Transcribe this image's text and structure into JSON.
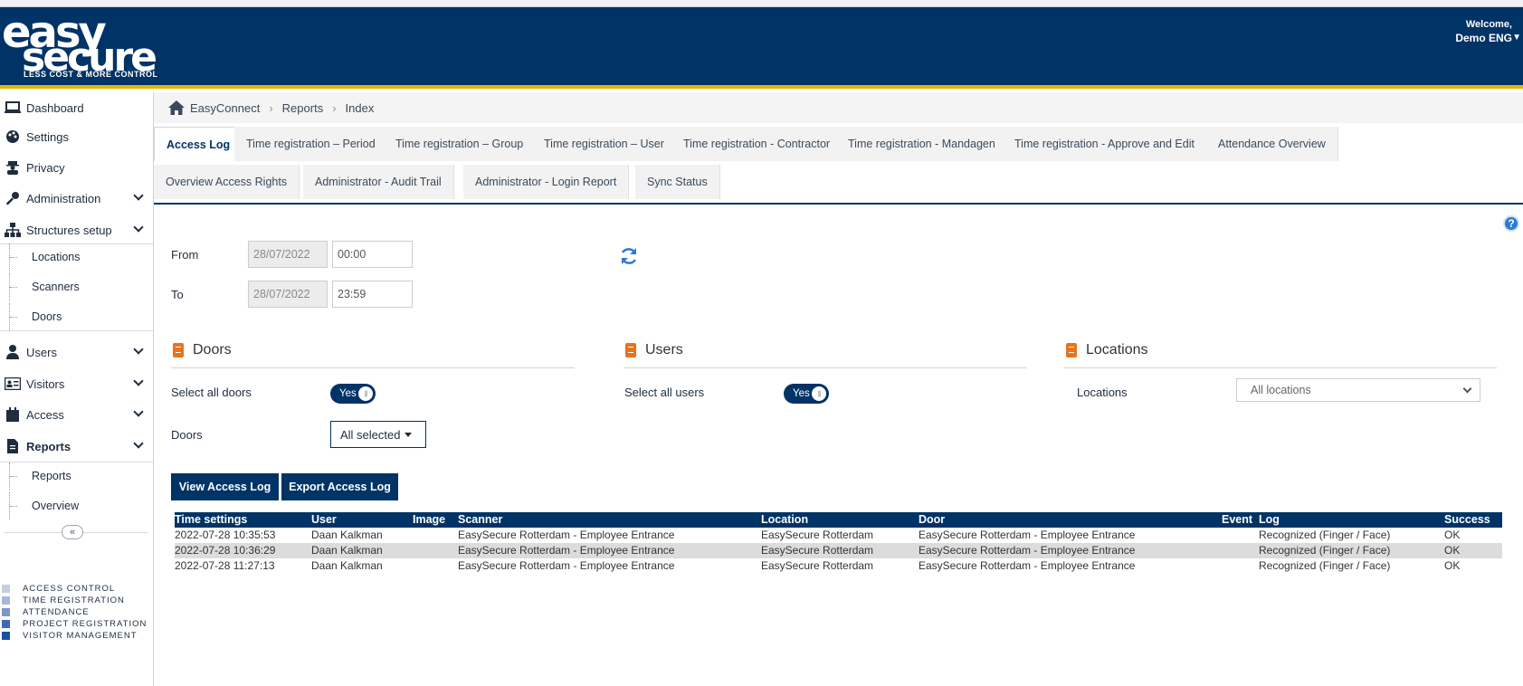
{
  "header": {
    "logo_line1": "easy",
    "logo_line2": "secure",
    "logo_tagline": "LESS COST & MORE CONTROL",
    "welcome": "Welcome,",
    "user_name": "Demo ENG"
  },
  "sidebar": {
    "items": [
      {
        "label": "Dashboard",
        "icon": "laptop-icon"
      },
      {
        "label": "Settings",
        "icon": "palette-icon"
      },
      {
        "label": "Privacy",
        "icon": "user-secret-icon"
      },
      {
        "label": "Administration",
        "icon": "key-icon"
      },
      {
        "label": "Structures setup",
        "icon": "sitemap-icon"
      },
      {
        "label": "Users",
        "icon": "user-icon"
      },
      {
        "label": "Visitors",
        "icon": "id-card-icon"
      },
      {
        "label": "Access",
        "icon": "calendar-icon"
      },
      {
        "label": "Reports",
        "icon": "file-icon"
      }
    ],
    "structures_sub": [
      "Locations",
      "Scanners",
      "Doors"
    ],
    "reports_sub": [
      "Reports",
      "Overview"
    ],
    "collapse_label": "«",
    "legend": [
      {
        "label": "ACCESS CONTROL",
        "color": "#c5cde0"
      },
      {
        "label": "TIME REGISTRATION",
        "color": "#a9b7d6"
      },
      {
        "label": "ATTENDANCE",
        "color": "#7f97c7"
      },
      {
        "label": "PROJECT REGISTRATION",
        "color": "#3e6bb5"
      },
      {
        "label": "VISITOR MANAGEMENT",
        "color": "#1a4fa3"
      }
    ]
  },
  "breadcrumb": [
    "EasyConnect",
    "Reports",
    "Index"
  ],
  "tabs_row1": [
    "Access Log",
    "Time registration – Period",
    "Time registration – Group",
    "Time registration – User",
    "Time registration - Contractor",
    "Time registration - Mandagen",
    "Time registration - Approve and Edit",
    "Attendance Overview"
  ],
  "tabs_row2": [
    "Overview Access Rights",
    "Administrator - Audit Trail",
    "Administrator - Login Report",
    "Sync Status"
  ],
  "filters": {
    "from_label": "From",
    "to_label": "To",
    "from_date": "28/07/2022",
    "from_time": "00:00",
    "to_date": "28/07/2022",
    "to_time": "23:59"
  },
  "doors": {
    "title": "Doors",
    "select_all_label": "Select all doors",
    "toggle": "Yes",
    "doors_label": "Doors",
    "doors_value": "All selected"
  },
  "users": {
    "title": "Users",
    "select_all_label": "Select all users",
    "toggle": "Yes"
  },
  "locations": {
    "title": "Locations",
    "label": "Locations",
    "value": "All locations"
  },
  "buttons": {
    "view": "View Access Log",
    "export": "Export Access Log"
  },
  "table": {
    "headers": [
      "Time settings",
      "User",
      "Image",
      "Scanner",
      "Location",
      "Door",
      "Event",
      "Log",
      "Success"
    ],
    "rows": [
      [
        "2022-07-28 10:35:53",
        "Daan Kalkman",
        "",
        "EasySecure Rotterdam - Employee Entrance",
        "EasySecure Rotterdam",
        "EasySecure Rotterdam - Employee Entrance",
        "",
        "Recognized (Finger / Face)",
        "OK"
      ],
      [
        "2022-07-28 10:36:29",
        "Daan Kalkman",
        "",
        "EasySecure Rotterdam - Employee Entrance",
        "EasySecure Rotterdam",
        "EasySecure Rotterdam - Employee Entrance",
        "",
        "Recognized (Finger / Face)",
        "OK"
      ],
      [
        "2022-07-28 11:27:13",
        "Daan Kalkman",
        "",
        "EasySecure Rotterdam - Employee Entrance",
        "EasySecure Rotterdam",
        "EasySecure Rotterdam - Employee Entrance",
        "",
        "Recognized (Finger / Face)",
        "OK"
      ]
    ]
  },
  "colors": {
    "brand": "#003366",
    "accent_line": "#e3b505",
    "section_icon": "#e8731c"
  }
}
